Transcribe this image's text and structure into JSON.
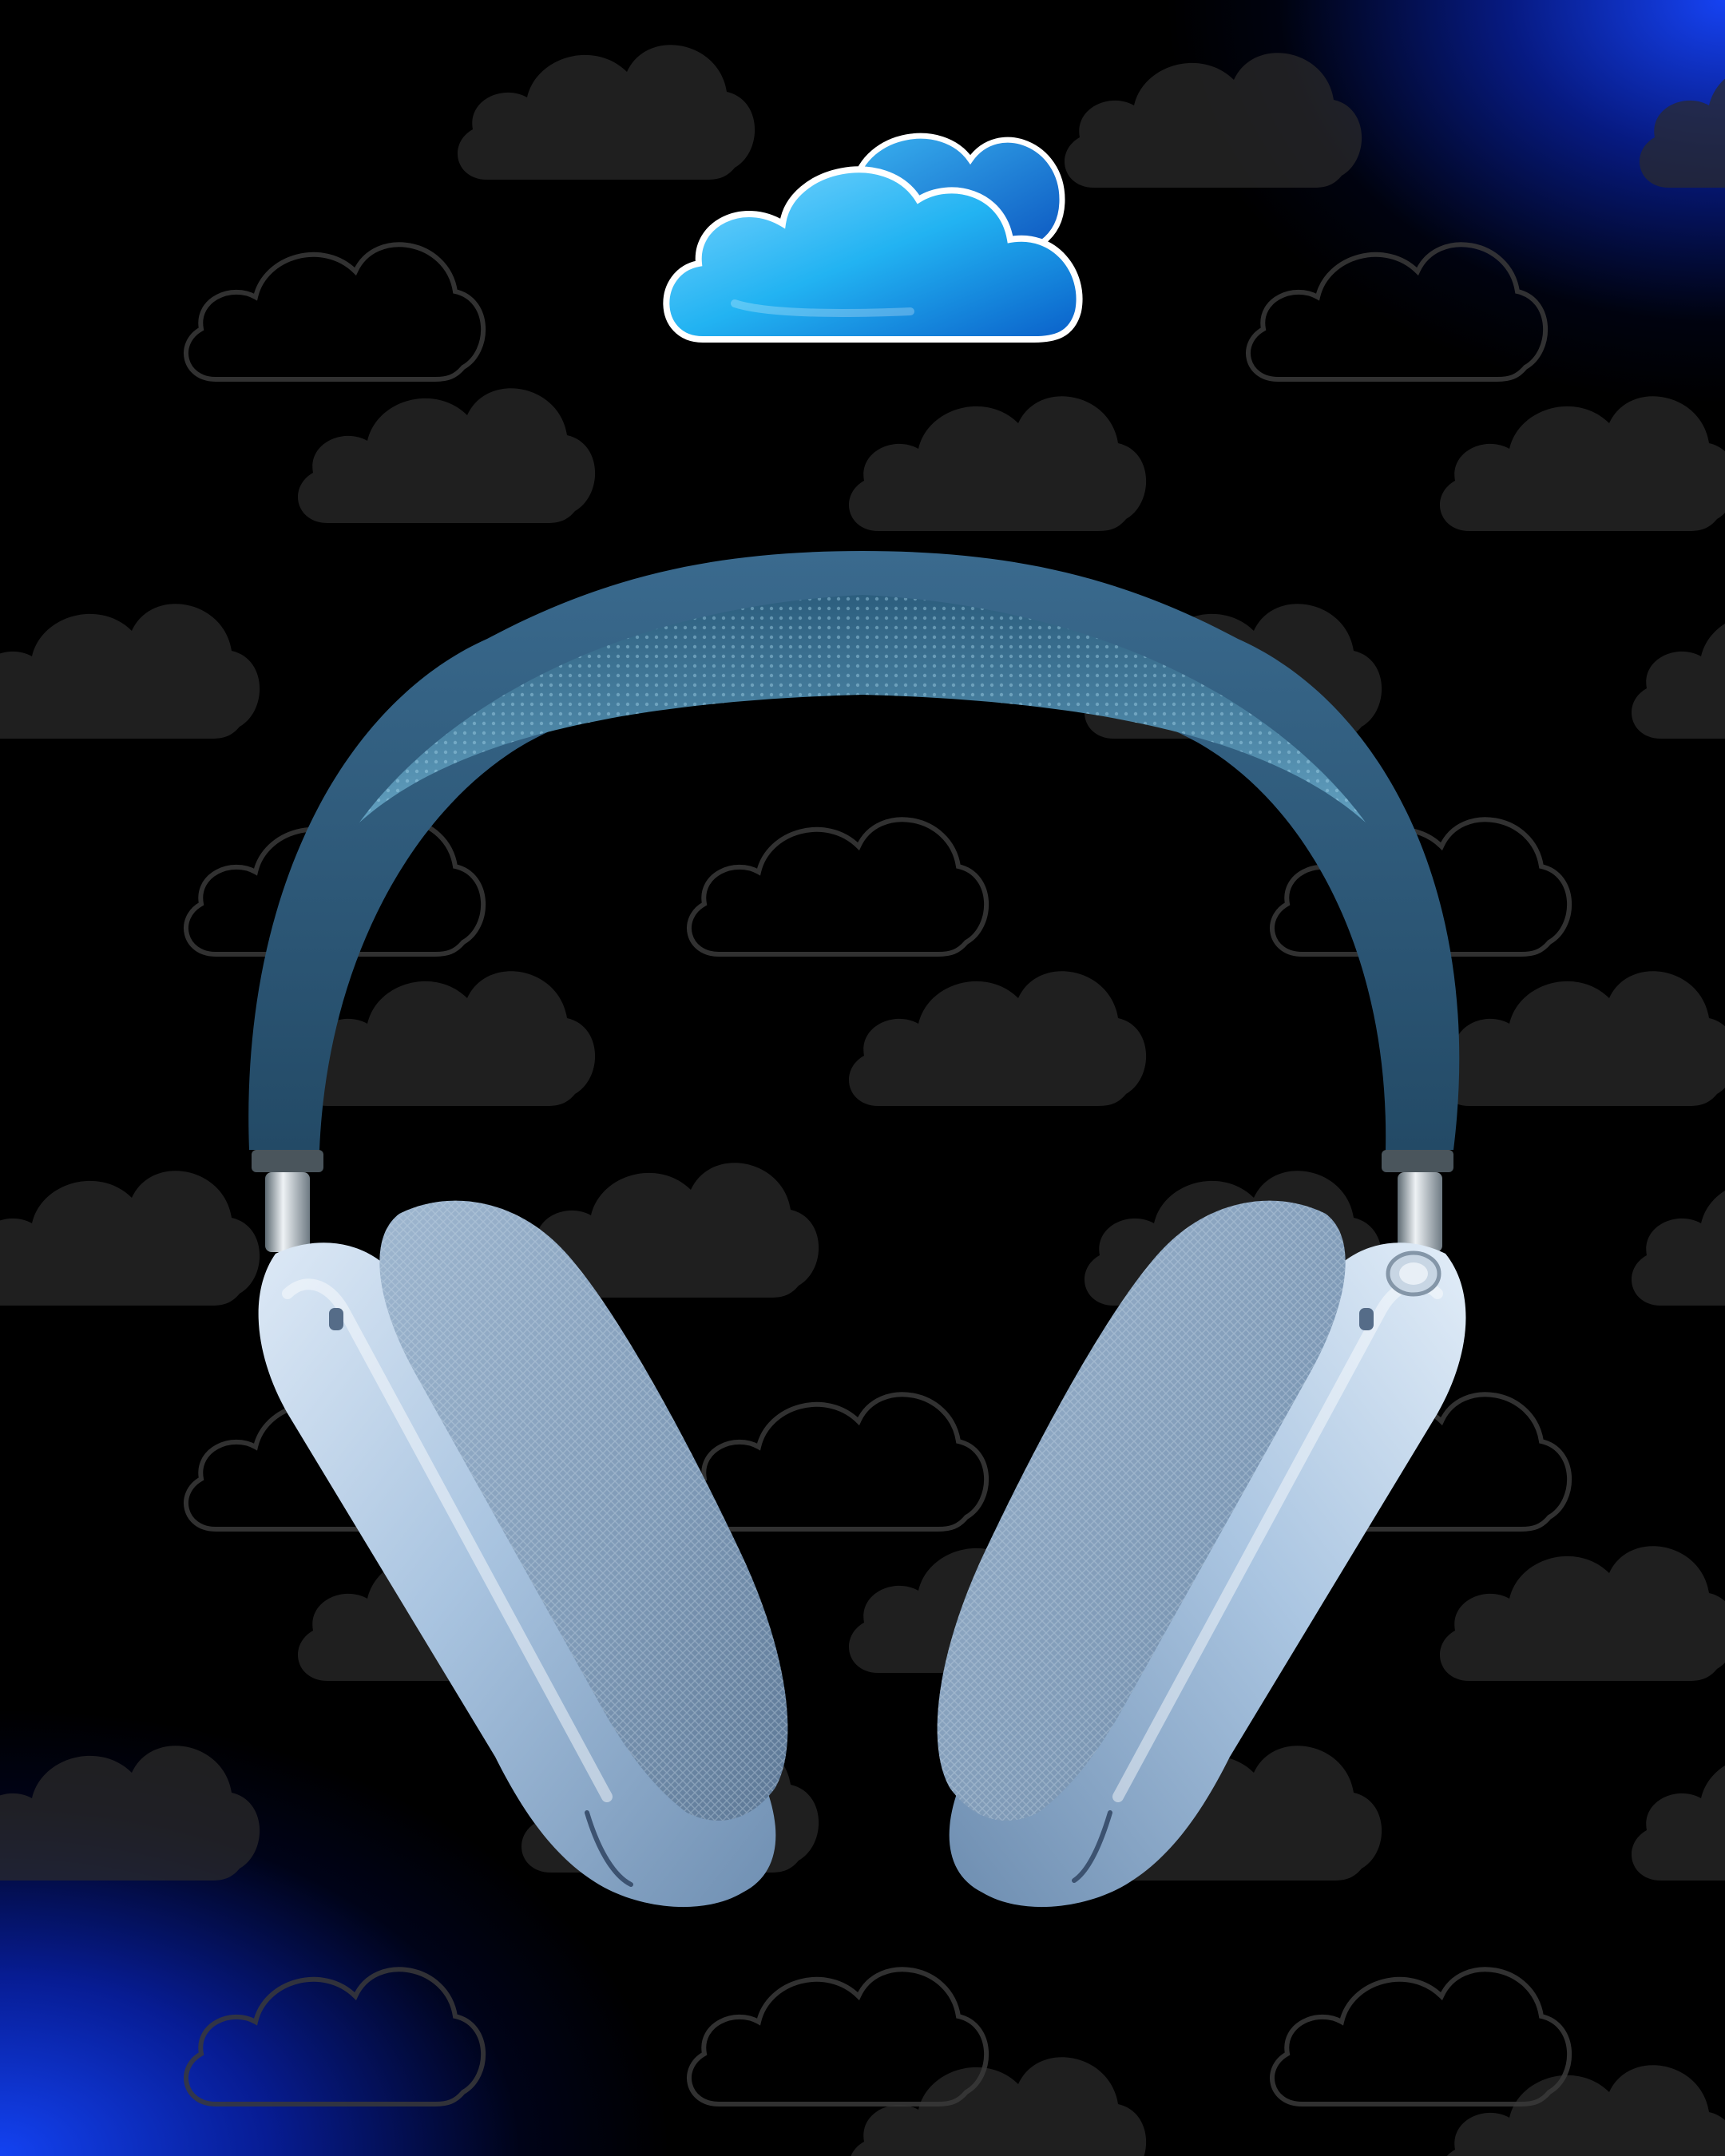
{
  "image": {
    "subject": "headphones-with-cloud-logo",
    "background_color": "#000000",
    "glow_color": "#1f4dff",
    "pattern_icon": "cloud-icon",
    "logo_icon": "icloud-logo-icon",
    "headphone_band_color": "#2e5e80",
    "headphone_cup_color": "#a9c4e0",
    "headphone_cushion_color": "#8aa6c2"
  }
}
